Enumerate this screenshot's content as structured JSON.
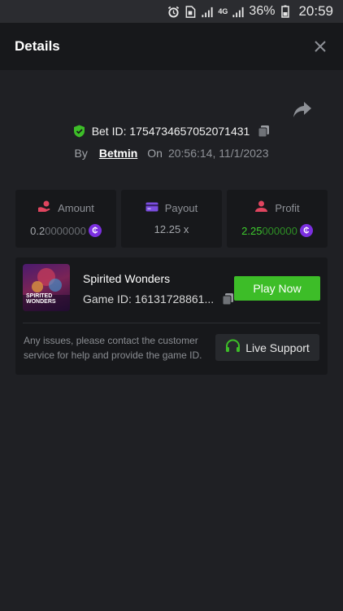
{
  "status_bar": {
    "network": "4G",
    "battery": "36%",
    "time": "20:59"
  },
  "header": {
    "title": "Details"
  },
  "bet": {
    "id_label": "Bet ID: 1754734657052071431",
    "by_label": "By",
    "user": "Betmin",
    "on_label": "On",
    "datetime": "20:56:14, 11/1/2023"
  },
  "stats": {
    "amount": {
      "label": "Amount",
      "value_lead": "0.2",
      "value_dim": "0000000",
      "icon": "coin-icon"
    },
    "payout": {
      "label": "Payout",
      "value": "12.25 x"
    },
    "profit": {
      "label": "Profit",
      "value_lead": "2.25",
      "value_dim": "000000",
      "icon": "coin-icon"
    }
  },
  "game": {
    "name": "Spirited Wonders",
    "thumb_text_line1": "SPIRITED",
    "thumb_text_line2": "WONDERS",
    "id_label": "Game ID: 16131728861...",
    "play_label": "Play Now"
  },
  "support": {
    "message": "Any issues, please contact the customer service for help and provide the game ID.",
    "button_label": "Live Support"
  },
  "colors": {
    "accent_green": "#3dbd28",
    "coin_purple": "#7b2fe0",
    "background": "#1f2024",
    "panel": "#17181b"
  }
}
